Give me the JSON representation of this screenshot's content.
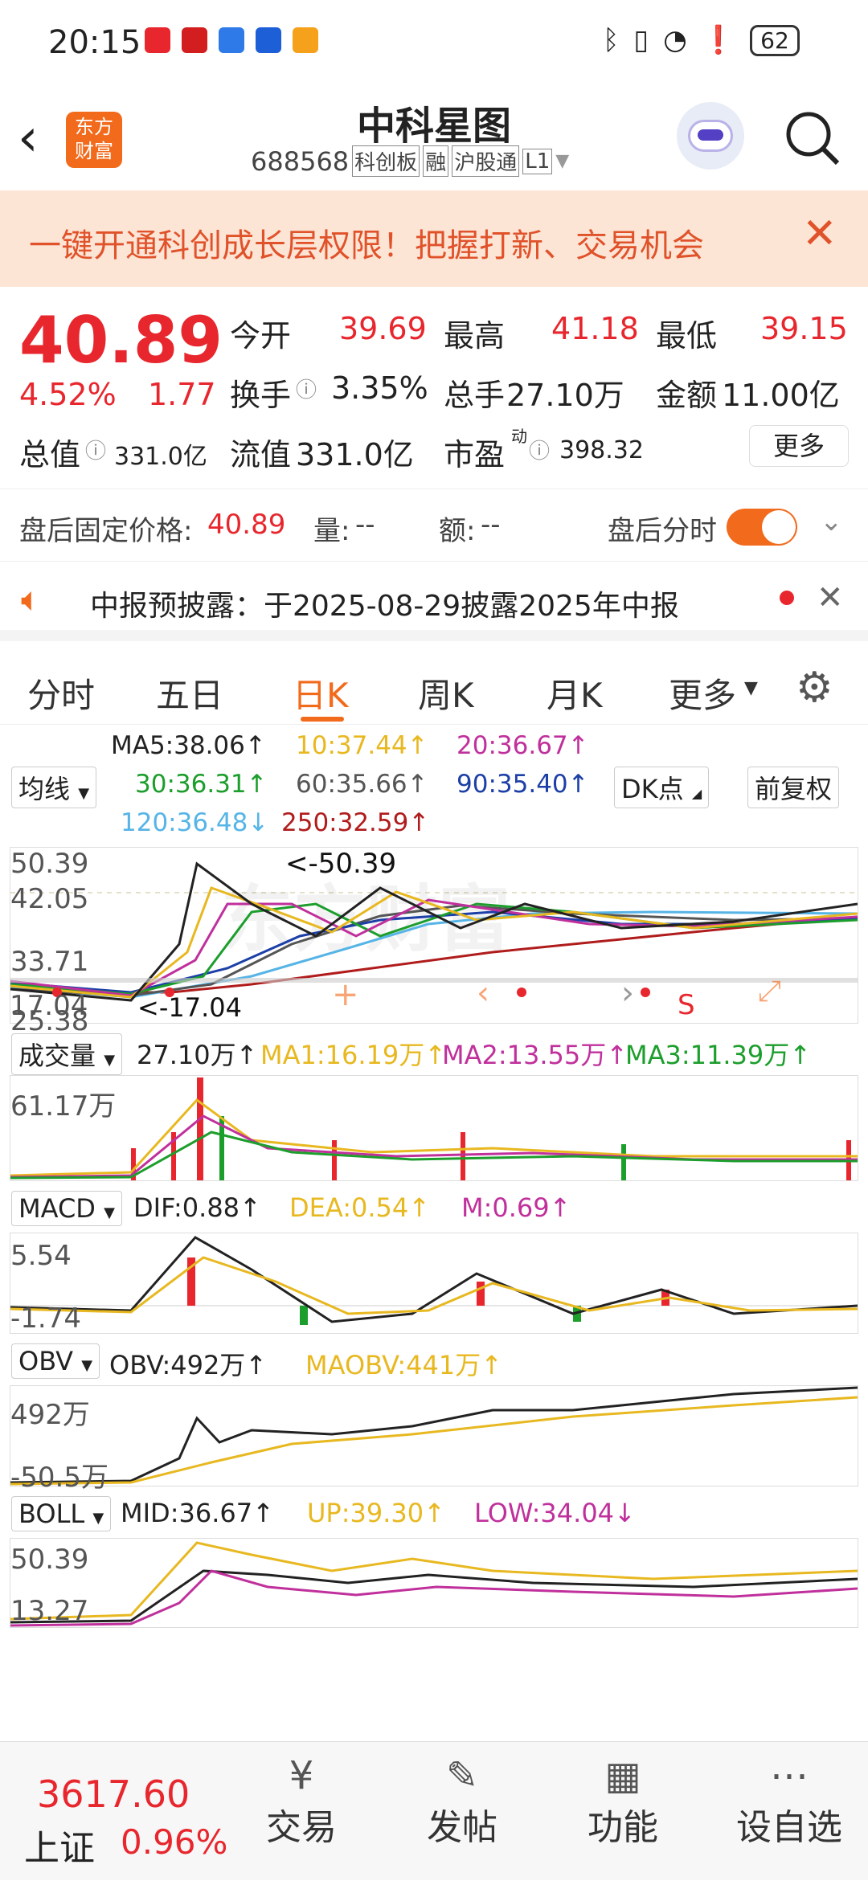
{
  "status_bar": {
    "time": "20:15",
    "battery": "62"
  },
  "header": {
    "title": "中科星图",
    "code": "688568",
    "tags": [
      "科创板",
      "融",
      "沪股通",
      "L1"
    ],
    "logo_text": [
      "东方",
      "财富"
    ]
  },
  "banner": {
    "text": "一键开通科创成长层权限！把握打新、交易机会"
  },
  "quote": {
    "price": "40.89",
    "change_pct": "4.52%",
    "change": "1.77",
    "open_label": "今开",
    "open": "39.69",
    "high_label": "最高",
    "high": "41.18",
    "low_label": "最低",
    "low": "39.15",
    "turnover_label": "换手",
    "turnover": "3.35%",
    "volume_label": "总手",
    "volume": "27.10万",
    "amount_label": "金额",
    "amount": "11.00亿",
    "mktcap_label": "总值",
    "mktcap": "331.0亿",
    "float_label": "流值",
    "float": "331.0亿",
    "pe_label": "市盈",
    "pe_sup": "动",
    "pe": "398.32",
    "more": "更多"
  },
  "after_hours": {
    "label": "盘后固定价格:",
    "price": "40.89",
    "vol_label": "量:",
    "vol": "--",
    "amt_label": "额:",
    "amt": "--",
    "toggle_label": "盘后分时"
  },
  "notice": {
    "text": "中报预披露：于2025-08-29披露2025年中报"
  },
  "tabs": [
    "分时",
    "五日",
    "日K",
    "周K",
    "月K",
    "更多"
  ],
  "active_tab": "日K",
  "ma_legend": {
    "selector": "均线",
    "items": [
      {
        "text": "MA5:38.06↑",
        "color": "#222222"
      },
      {
        "text": "10:37.44↑",
        "color": "#e8b820"
      },
      {
        "text": "20:36.67↑",
        "color": "#c0309c"
      },
      {
        "text": "30:36.31↑",
        "color": "#1c9e2c"
      },
      {
        "text": "60:35.66↑",
        "color": "#555555"
      },
      {
        "text": "90:35.40↑",
        "color": "#1c3fa8"
      },
      {
        "text": "120:36.48↓",
        "color": "#56b4e6"
      },
      {
        "text": "250:32.59↑",
        "color": "#b01c1c"
      }
    ],
    "dk_button": "DK点",
    "adjust_button": "前复权"
  },
  "kline": {
    "max_label": "50.39",
    "axis": [
      "50.39",
      "42.05",
      "33.71",
      "25.38",
      "17.04"
    ],
    "max_marker": "<-50.39",
    "min_marker": "<-17.04",
    "signal": "S"
  },
  "volume_panel": {
    "selector": "成交量",
    "value": "27.10万↑",
    "ma1": "MA1:16.19万↑",
    "ma2": "MA2:13.55万↑",
    "ma3": "MA3:11.39万↑",
    "axis_top": "61.17万"
  },
  "macd_panel": {
    "selector": "MACD",
    "dif": "DIF:0.88↑",
    "dea": "DEA:0.54↑",
    "m": "M:0.69↑",
    "axis_top": "5.54",
    "axis_bottom": "-1.74"
  },
  "obv_panel": {
    "selector": "OBV",
    "obv": "OBV:492万↑",
    "maobv": "MAOBV:441万↑",
    "axis_top": "492万",
    "axis_bottom": "-50.5万"
  },
  "boll_panel": {
    "selector": "BOLL",
    "mid": "MID:36.67↑",
    "up": "UP:39.30↑",
    "low": "LOW:34.04↓",
    "axis_top": "50.39",
    "axis_bottom": "13.27"
  },
  "bottom_bar": {
    "index_value": "3617.60",
    "index_name": "上证",
    "index_change": "0.96%",
    "items": [
      "交易",
      "发帖",
      "功能",
      "设自选"
    ]
  },
  "colors": {
    "red": "#e8262d",
    "green": "#1c9e2c",
    "orange": "#f26a1b",
    "banner_bg": "#fde5d6"
  }
}
